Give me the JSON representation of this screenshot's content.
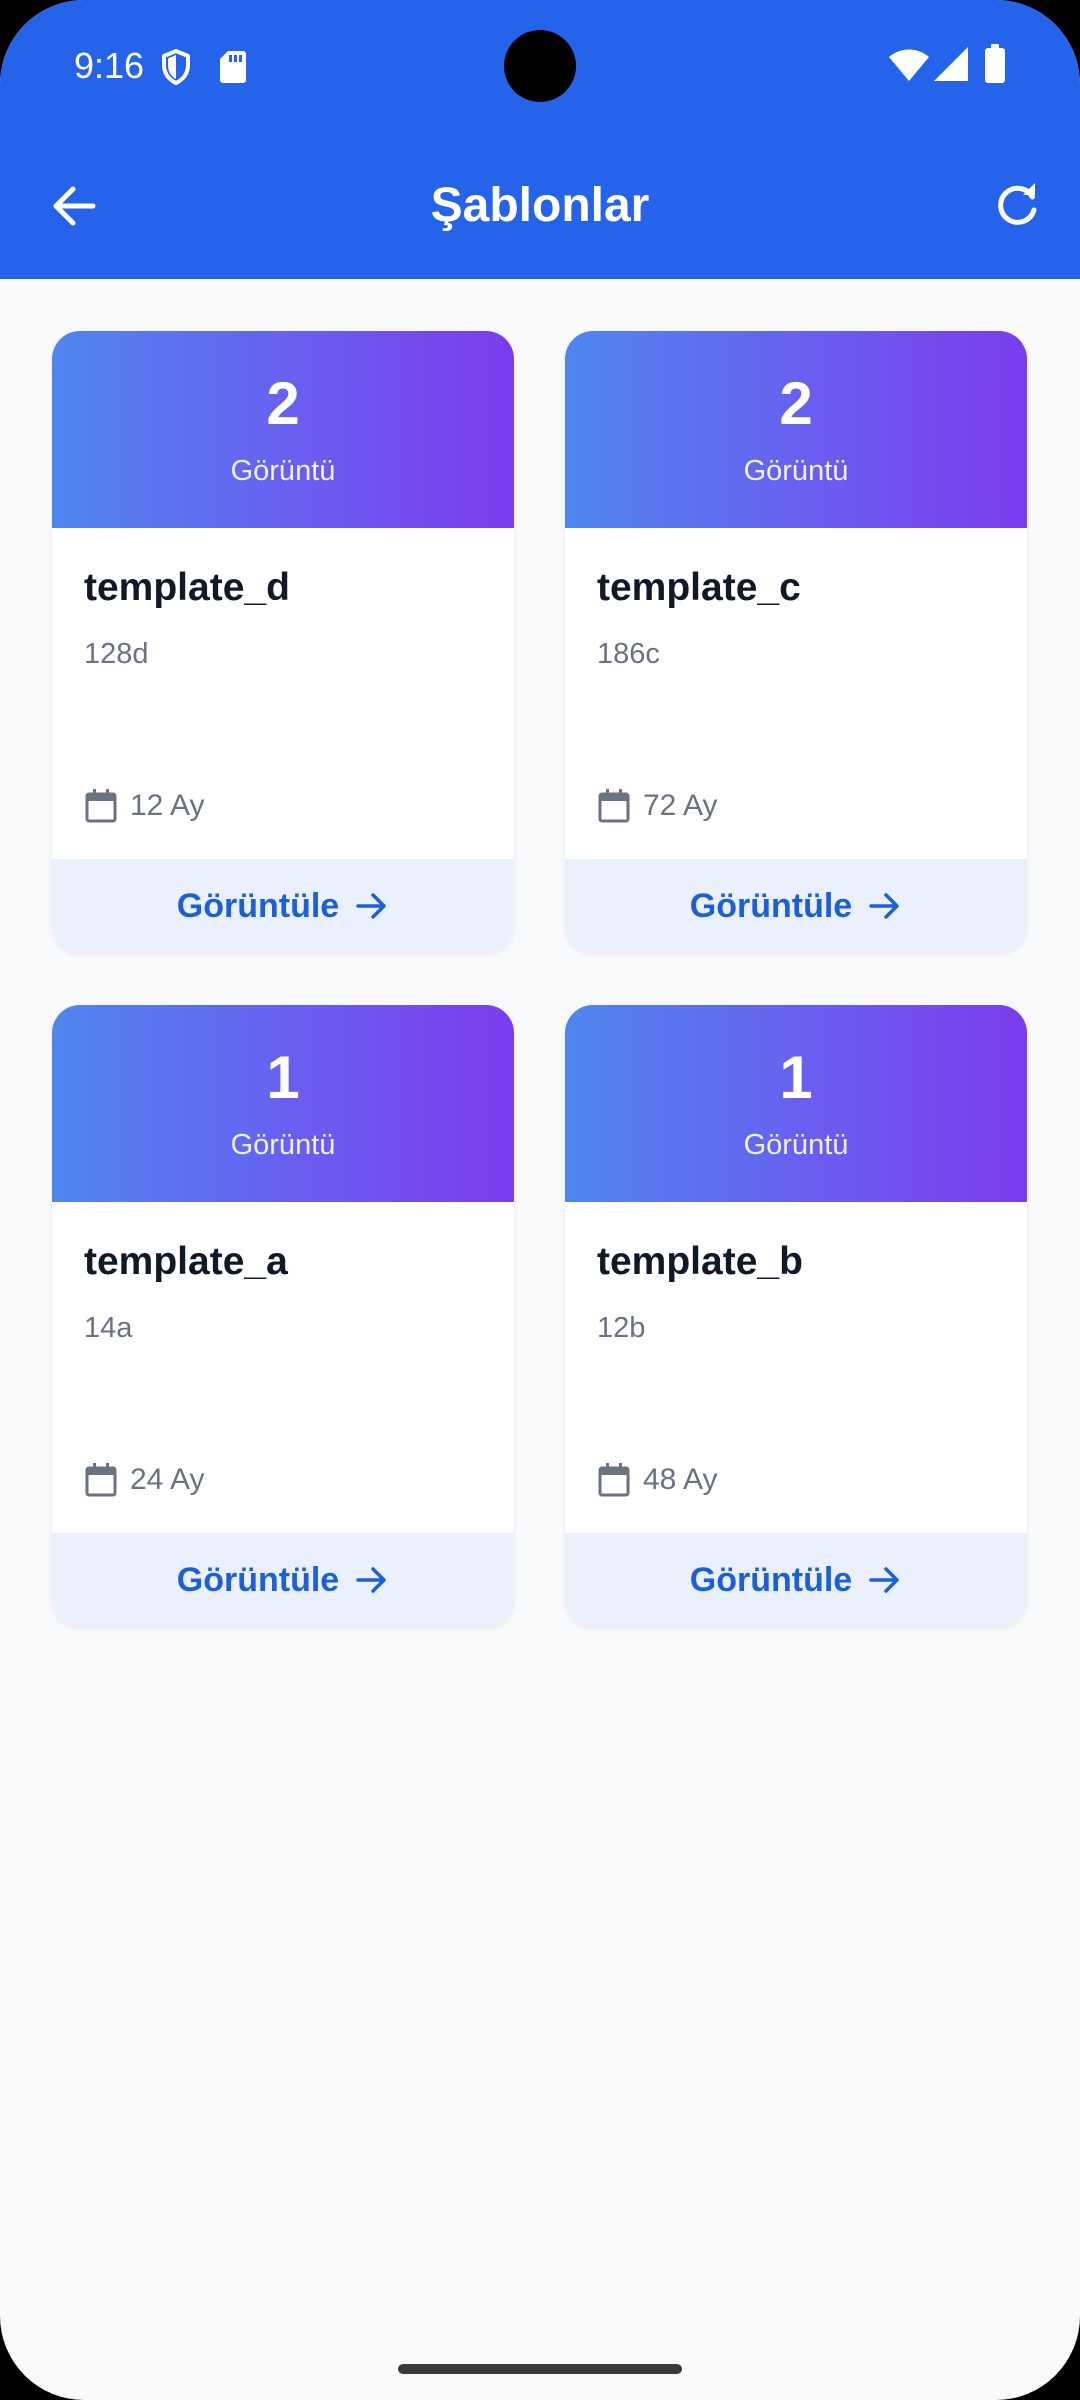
{
  "status_bar": {
    "time": "9:16",
    "icons_left": [
      "shield-icon",
      "sd-card-icon"
    ],
    "icons_right": [
      "wifi-icon",
      "cellular-signal-icon",
      "battery-icon"
    ]
  },
  "app_bar": {
    "title": "Şablonlar",
    "back_icon": "arrow-left-icon",
    "refresh_icon": "refresh-icon"
  },
  "colors": {
    "primary": "#2563eb",
    "gradient_start": "#4f86ee",
    "gradient_end": "#7b3cee",
    "action_background": "#eaf1fd",
    "action_text": "#1d5fd6",
    "background": "#f8fafc"
  },
  "templates": [
    {
      "count": "2",
      "count_label": "Görüntü",
      "name": "template_d",
      "code": "128d",
      "duration": "12 Ay",
      "meta_icon": "calendar-icon",
      "action_label": "Görüntüle",
      "action_icon": "arrow-right-icon"
    },
    {
      "count": "2",
      "count_label": "Görüntü",
      "name": "template_c",
      "code": "186c",
      "duration": "72 Ay",
      "meta_icon": "calendar-icon",
      "action_label": "Görüntüle",
      "action_icon": "arrow-right-icon"
    },
    {
      "count": "1",
      "count_label": "Görüntü",
      "name": "template_a",
      "code": "14a",
      "duration": "24 Ay",
      "meta_icon": "calendar-icon",
      "action_label": "Görüntüle",
      "action_icon": "arrow-right-icon"
    },
    {
      "count": "1",
      "count_label": "Görüntü",
      "name": "template_b",
      "code": "12b",
      "duration": "48 Ay",
      "meta_icon": "calendar-icon",
      "action_label": "Görüntüle",
      "action_icon": "arrow-right-icon"
    }
  ]
}
